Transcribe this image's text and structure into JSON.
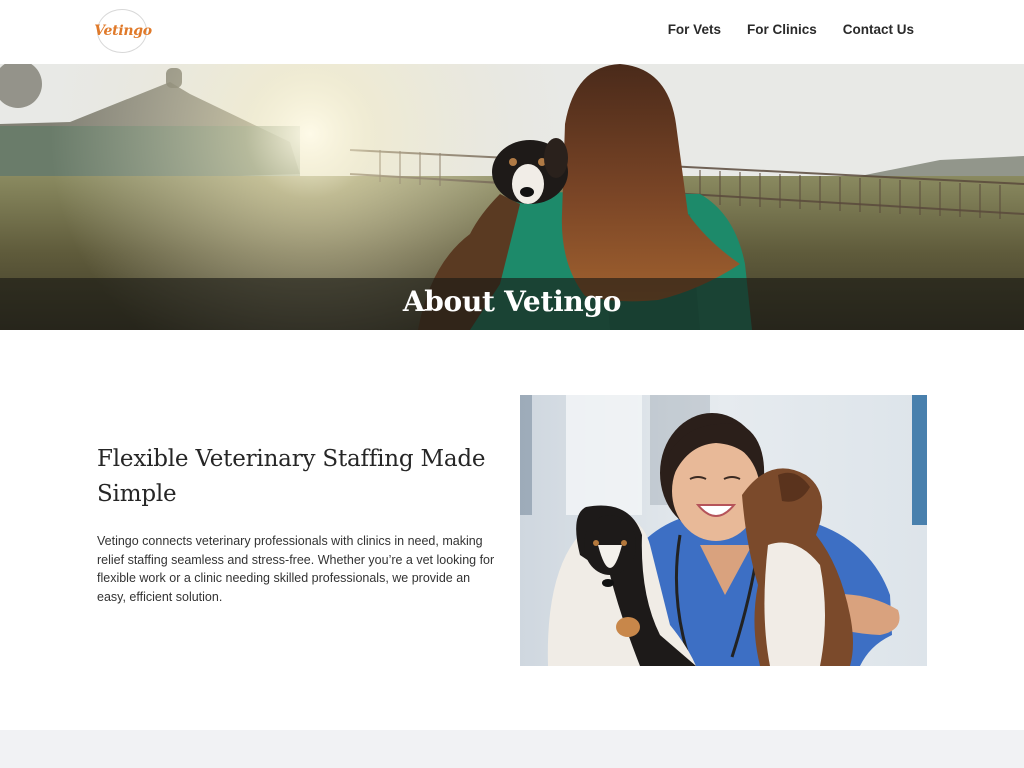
{
  "header": {
    "logo_text": "Vetingo",
    "nav": [
      {
        "label": "For Vets"
      },
      {
        "label": "For Clinics"
      },
      {
        "label": "Contact Us"
      }
    ]
  },
  "hero": {
    "title": "About Vetingo",
    "image": "woman-in-green-scrubs-holding-puppy-at-sunset"
  },
  "about": {
    "heading": "Flexible Veterinary Staffing Made Simple",
    "body": "Vetingo connects veterinary professionals with clinics in need, making relief staffing seamless and stress-free. Whether you’re a vet looking for flexible work or a clinic needing skilled professionals, we provide an easy, efficient solution.",
    "image": "smiling-vet-in-blue-scrubs-with-two-puppies"
  },
  "colors": {
    "brand_orange": "#e07a2a",
    "hero_scrubs_green": "#1d8a6a",
    "vet_scrubs_blue": "#3d6fc4",
    "bottom_band": "#f1f2f4"
  }
}
